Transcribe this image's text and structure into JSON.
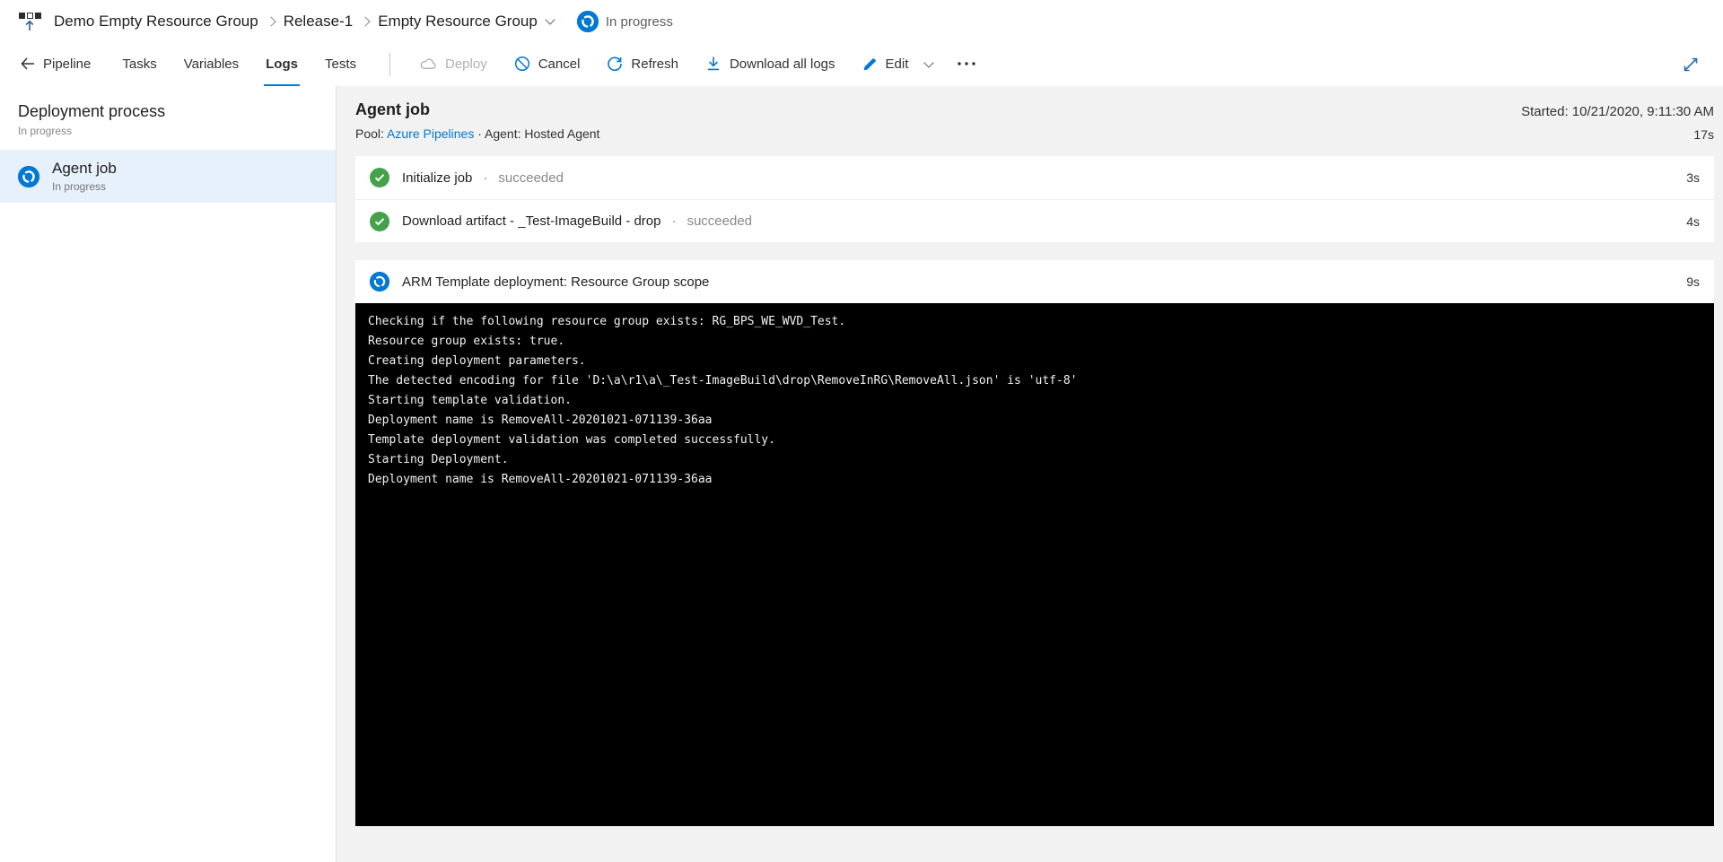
{
  "breadcrumb": {
    "items": [
      "Demo Empty Resource Group",
      "Release-1",
      "Empty Resource Group"
    ],
    "status": "In progress"
  },
  "toolbar": {
    "back_label": "Pipeline",
    "tabs": [
      {
        "label": "Tasks"
      },
      {
        "label": "Variables"
      },
      {
        "label": "Logs"
      },
      {
        "label": "Tests"
      }
    ],
    "actions": {
      "deploy": "Deploy",
      "cancel": "Cancel",
      "refresh": "Refresh",
      "download": "Download all logs",
      "edit": "Edit"
    }
  },
  "sidebar": {
    "title": "Deployment process",
    "subtitle": "In progress",
    "items": [
      {
        "label": "Agent job",
        "status": "In progress"
      }
    ]
  },
  "main": {
    "title": "Agent job",
    "pool_label": "Pool:",
    "pool_link": "Azure Pipelines",
    "meta_separator": "·",
    "agent_info": "Agent: Hosted Agent",
    "started": "Started: 10/21/2020, 9:11:30 AM",
    "total_duration": "17s",
    "step_separator": "·",
    "steps": [
      {
        "label": "Initialize job",
        "status": "succeeded",
        "duration": "3s"
      },
      {
        "label": "Download artifact - _Test-ImageBuild - drop",
        "status": "succeeded",
        "duration": "4s"
      }
    ],
    "active_step": {
      "label": "ARM Template deployment: Resource Group scope",
      "duration": "9s"
    },
    "log_lines": [
      "Checking if the following resource group exists: RG_BPS_WE_WVD_Test.",
      "Resource group exists: true.",
      "Creating deployment parameters.",
      "The detected encoding for file 'D:\\a\\r1\\a\\_Test-ImageBuild\\drop\\RemoveInRG\\RemoveAll.json' is 'utf-8'",
      "Starting template validation.",
      "Deployment name is RemoveAll-20201021-071139-36aa",
      "Template deployment validation was completed successfully.",
      "Starting Deployment.",
      "Deployment name is RemoveAll-20201021-071139-36aa"
    ]
  },
  "colors": {
    "accent_blue": "#0078d4",
    "success_green": "#46a24a",
    "selected_row_bg": "#e6f1fb",
    "panel_bg": "#f2f2f2",
    "console_bg": "#000000"
  }
}
